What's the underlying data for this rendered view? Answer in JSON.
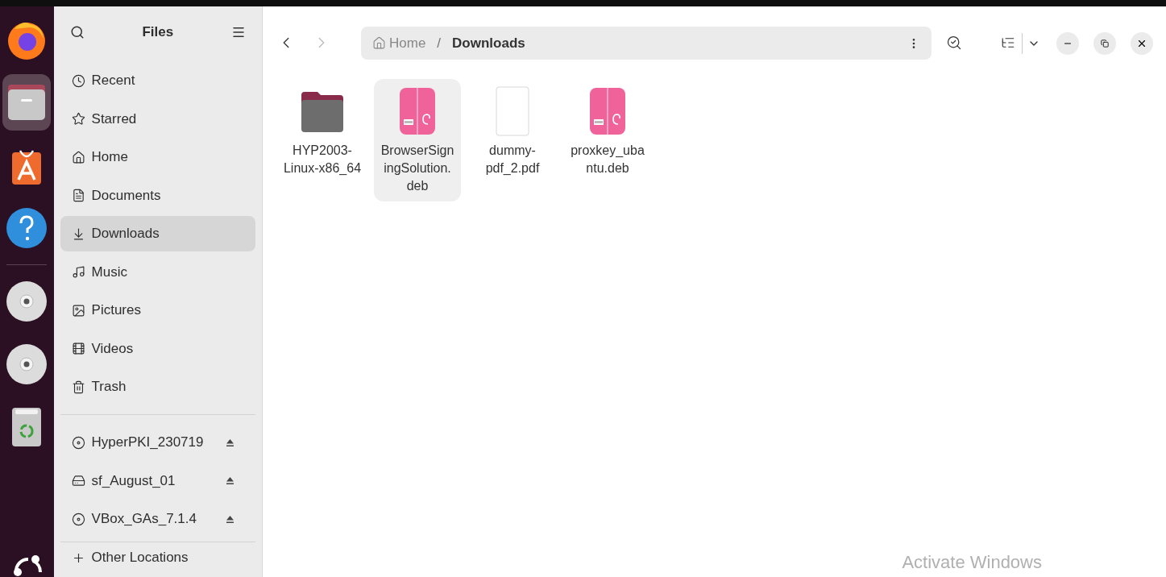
{
  "dock": {
    "items": [
      {
        "kind": "firefox",
        "active": false
      },
      {
        "kind": "files",
        "active": true
      },
      {
        "kind": "store",
        "active": false
      },
      {
        "kind": "help",
        "active": false
      },
      {
        "kind": "separator"
      },
      {
        "kind": "disc",
        "active": false
      },
      {
        "kind": "disc",
        "active": false
      },
      {
        "kind": "trash",
        "active": false
      }
    ]
  },
  "sidebar": {
    "title": "Files",
    "places": [
      {
        "label": "Recent",
        "kind": "clock",
        "selected": false
      },
      {
        "label": "Starred",
        "kind": "star",
        "selected": false
      },
      {
        "label": "Home",
        "kind": "home",
        "selected": false
      },
      {
        "label": "Documents",
        "kind": "document",
        "selected": false
      },
      {
        "label": "Downloads",
        "kind": "download",
        "selected": true
      },
      {
        "label": "Music",
        "kind": "music",
        "selected": false
      },
      {
        "label": "Pictures",
        "kind": "picture",
        "selected": false
      },
      {
        "label": "Videos",
        "kind": "film",
        "selected": false
      },
      {
        "label": "Trash",
        "kind": "trash",
        "selected": false
      }
    ],
    "devices": [
      {
        "label": "HyperPKI_230719",
        "kind": "disc",
        "eject": true
      },
      {
        "label": "sf_August_01",
        "kind": "drive",
        "eject": true
      },
      {
        "label": "VBox_GAs_7.1.4",
        "kind": "disc",
        "eject": true
      }
    ],
    "other": "Other Locations"
  },
  "pathbar": {
    "segments": [
      "Home",
      "Downloads"
    ],
    "separator": "/"
  },
  "files": [
    {
      "name": "HYP2003-\nLinux-x86_64",
      "kind": "folder",
      "selected": false
    },
    {
      "name": "BrowserSign\ningSolution.\ndeb",
      "kind": "deb",
      "selected": true
    },
    {
      "name": "dummy-\npdf_2.pdf",
      "kind": "pdf",
      "selected": false
    },
    {
      "name": "proxkey_uba\nntu.deb",
      "kind": "deb",
      "selected": false
    }
  ],
  "overlay": "Activate Windows"
}
